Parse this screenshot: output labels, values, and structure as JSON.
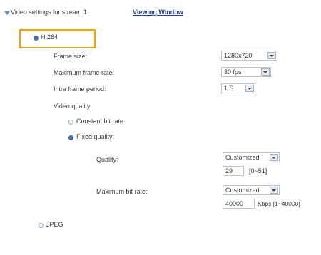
{
  "header": {
    "video_settings_label": "Video settings for stream 1",
    "viewing_window_link": "Viewing Window"
  },
  "codec": {
    "h264_label": "H.264",
    "jpeg_label": "JPEG"
  },
  "h264": {
    "frame_size_label": "Frame size:",
    "frame_size_value": "1280x720",
    "max_frame_rate_label": "Maximum frame rate:",
    "max_frame_rate_value": "30 fps",
    "intra_frame_label": "Intra frame period:",
    "intra_frame_value": "1 S",
    "video_quality_label": "Video quality",
    "constant_bitrate_label": "Constant bit rate:",
    "fixed_quality_label": "Fixed quality:",
    "quality_label": "Quality:",
    "quality_select_value": "Customized",
    "quality_input_value": "29",
    "quality_range": "[0~51]",
    "max_bitrate_label": "Maximum bit rate:",
    "max_bitrate_select_value": "Customized",
    "max_bitrate_input_value": "40000",
    "max_bitrate_unit": "Kbps [1~40000]"
  },
  "colors": {
    "highlight": "#f0a500",
    "link": "#1f3f8f",
    "radio_selected": "#4e79b3"
  }
}
